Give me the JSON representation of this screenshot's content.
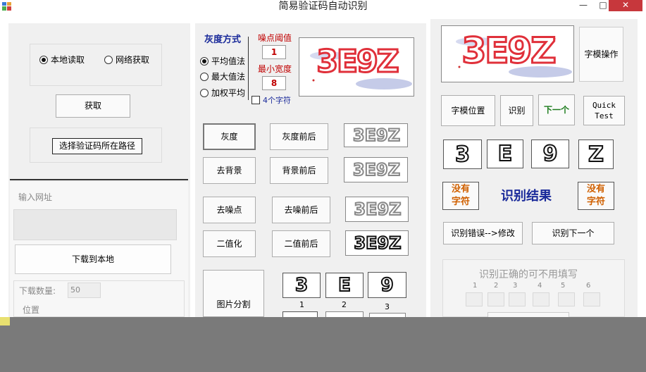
{
  "window": {
    "title": "简易验证码自动识别",
    "min_glyph": "—",
    "max_glyph": "□",
    "close_glyph": "✕"
  },
  "left": {
    "radio_local": "本地读取",
    "radio_network": "网络获取",
    "fetch_button": "获取",
    "choose_path_button": "选择验证码所在路径",
    "url_label": "输入网址",
    "download_button": "下载到本地",
    "download_count_label": "下载数量:",
    "download_count_value": "50",
    "position_label": "位置"
  },
  "middle": {
    "gray_mode_label": "灰度方式",
    "radio_avg": "平均值法",
    "radio_max": "最大值法",
    "radio_weighted": "加权平均",
    "noise_threshold_label": "噪点阈值",
    "noise_threshold_value": "1",
    "min_width_label": "最小宽度",
    "min_width_value": "8",
    "four_chars_label": "4个字符",
    "captcha_text": "3E9Z",
    "btn_gray": "灰度",
    "btn_gray_compare": "灰度前后",
    "btn_remove_bg": "去背景",
    "btn_bg_compare": "背景前后",
    "btn_denoise": "去噪点",
    "btn_denoise_compare": "去噪前后",
    "btn_binarize": "二值化",
    "btn_binarize_compare": "二值前后",
    "btn_split": "图片分割",
    "segments": [
      "3",
      "E",
      "9"
    ],
    "segment_labels": [
      "1",
      "2",
      "3"
    ]
  },
  "right": {
    "font_lib_button": "字模操作",
    "font_pos_button": "字模位置",
    "recognize_button": "识别",
    "next_button": "下一个",
    "quick_test_button": "Quick\nTest",
    "chars": [
      "3",
      "E",
      "9",
      "Z"
    ],
    "no_char_left": "没有\n字符",
    "result_label": "识别结果",
    "no_char_right": "没有\n字符",
    "fix_error_button": "识别错误-->修改",
    "recognize_next_button": "识别下一个",
    "hint_label": "识别正确的可不用填写",
    "slot_numbers": [
      "1",
      "2",
      "3",
      "4",
      "5",
      "6"
    ]
  },
  "colors": {
    "panel_bg": "#f0f0f0",
    "accent_red": "#c00000",
    "result_navy": "#1a2a9a",
    "no_char_orange": "#d06000",
    "close_red": "#c7373c"
  }
}
